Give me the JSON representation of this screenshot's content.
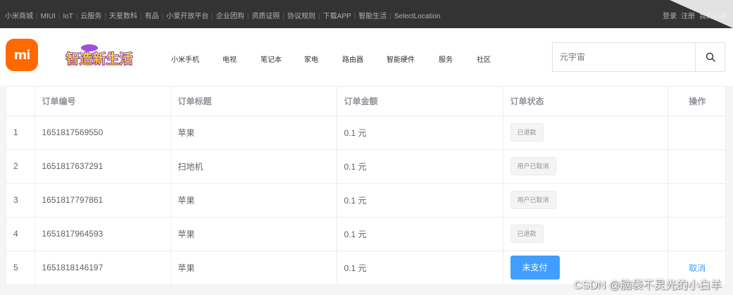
{
  "topbar": {
    "left_links": [
      "小米商城",
      "MIUI",
      "IoT",
      "云服务",
      "天星数科",
      "有品",
      "小爱开放平台",
      "企业团购",
      "资质证照",
      "协议规则",
      "下载APP",
      "智能生活",
      "SelectLocation"
    ],
    "right_links": [
      "登录",
      "注册",
      "我的订单"
    ]
  },
  "header": {
    "logo_text": "mi",
    "banner_text": "智造新生活",
    "nav": [
      "小米手机",
      "电视",
      "笔记本",
      "家电",
      "路由器",
      "智能硬件",
      "服务",
      "社区"
    ],
    "search_placeholder": "元宇宙"
  },
  "table": {
    "columns": [
      "",
      "订单编号",
      "订单标题",
      "订单金额",
      "订单状态",
      "操作"
    ],
    "rows": [
      {
        "index": "1",
        "order_no": "1651817569550",
        "title": "苹果",
        "amount": "0.1 元",
        "status": "已退款",
        "status_kind": "tag",
        "action": ""
      },
      {
        "index": "2",
        "order_no": "1651817637291",
        "title": "扫地机",
        "amount": "0.1 元",
        "status": "用户已取消",
        "status_kind": "tag",
        "action": ""
      },
      {
        "index": "3",
        "order_no": "1651817797861",
        "title": "苹果",
        "amount": "0.1 元",
        "status": "用户已取消",
        "status_kind": "tag",
        "action": ""
      },
      {
        "index": "4",
        "order_no": "1651817964593",
        "title": "苹果",
        "amount": "0.1 元",
        "status": "已退款",
        "status_kind": "tag",
        "action": ""
      },
      {
        "index": "5",
        "order_no": "1651818146197",
        "title": "苹果",
        "amount": "0.1 元",
        "status": "未支付",
        "status_kind": "button",
        "action": "取消"
      }
    ]
  },
  "watermark": "CSDN @脑袋不灵光的小白羊",
  "colors": {
    "brand": "#ff6900",
    "primary": "#409eff",
    "topbar": "#333333"
  }
}
